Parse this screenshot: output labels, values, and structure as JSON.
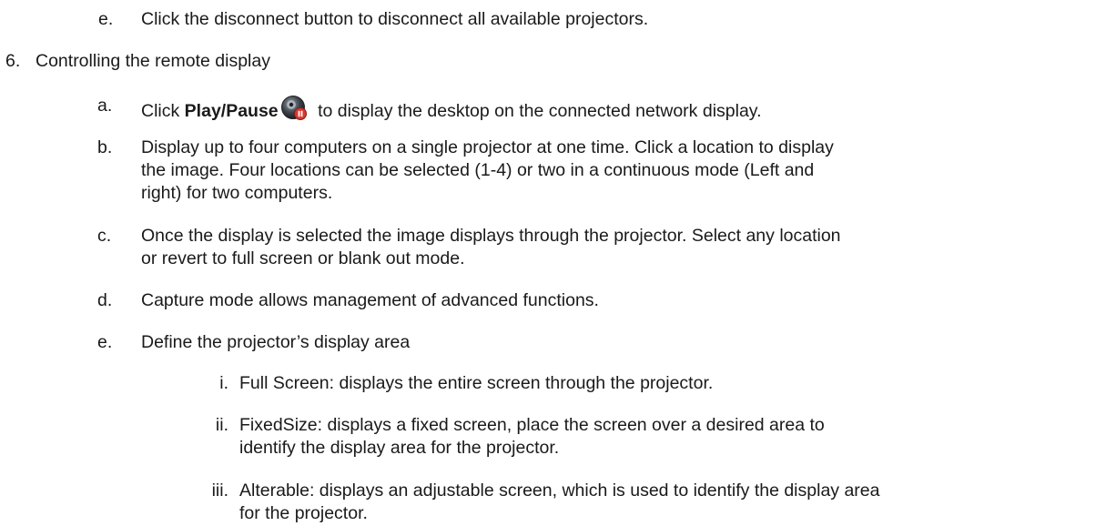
{
  "doc": {
    "item_e_top": {
      "marker": "e.",
      "text": "Click the disconnect button to disconnect all available projectors."
    },
    "section6": {
      "marker": "6.",
      "text": "Controlling the remote display"
    },
    "item_a": {
      "marker": "a.",
      "pre": "Click ",
      "bold": "Play/Pause",
      "icon": "play-pause-icon",
      "post": " to display the desktop on the connected network display."
    },
    "item_b": {
      "marker": "b.",
      "lines": [
        "Display up to four computers on a single projector at one time. Click a location to display",
        "the image. Four locations can be selected (1-4) or two in a continuous mode (Left and",
        "right) for two computers."
      ]
    },
    "item_c": {
      "marker": "c.",
      "lines": [
        "Once the display is selected the image displays through the projector. Select any location",
        "or revert to full screen or blank out mode."
      ]
    },
    "item_d": {
      "marker": "d.",
      "text": "Capture mode allows management of advanced functions."
    },
    "item_e": {
      "marker": "e.",
      "text": "Define the projector’s display area"
    },
    "item_i": {
      "marker": "i.",
      "text": "Full Screen: displays the entire screen through the projector."
    },
    "item_ii": {
      "marker": "ii.",
      "lines": [
        "FixedSize: displays a fixed screen, place the screen over a desired area to",
        "identify the display area for the projector."
      ]
    },
    "item_iii": {
      "marker": "iii.",
      "lines": [
        "Alterable: displays an adjustable screen, which is used to identify the display area",
        "for the projector."
      ]
    }
  }
}
